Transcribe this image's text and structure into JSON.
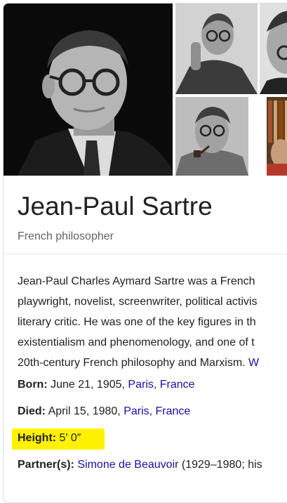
{
  "entity": {
    "name": "Jean-Paul Sartre",
    "subtitle": "French philosopher"
  },
  "description": {
    "lines": [
      "Jean-Paul Charles Aymard Sartre was a French",
      "playwright, novelist, screenwriter, political activis",
      "literary critic. He was one of the key figures in th",
      "existentialism and phenomenology, and one of t",
      "20th-century French philosophy and Marxism. "
    ],
    "more_link": "W"
  },
  "facts": {
    "born": {
      "label": "Born:",
      "value": " June 21, 1905, ",
      "link": "Paris, France"
    },
    "died": {
      "label": "Died:",
      "value": " April 15, 1980, ",
      "link": "Paris, France"
    },
    "height": {
      "label": "Height:",
      "value": " 5′ 0″"
    },
    "partner": {
      "label": "Partner(s):",
      "link": "Simone de Beauvoir",
      "value": " (1929–1980; his"
    }
  },
  "colors": {
    "link": "#1a0dab",
    "highlight": "#fff200",
    "muted": "#5f6368"
  }
}
